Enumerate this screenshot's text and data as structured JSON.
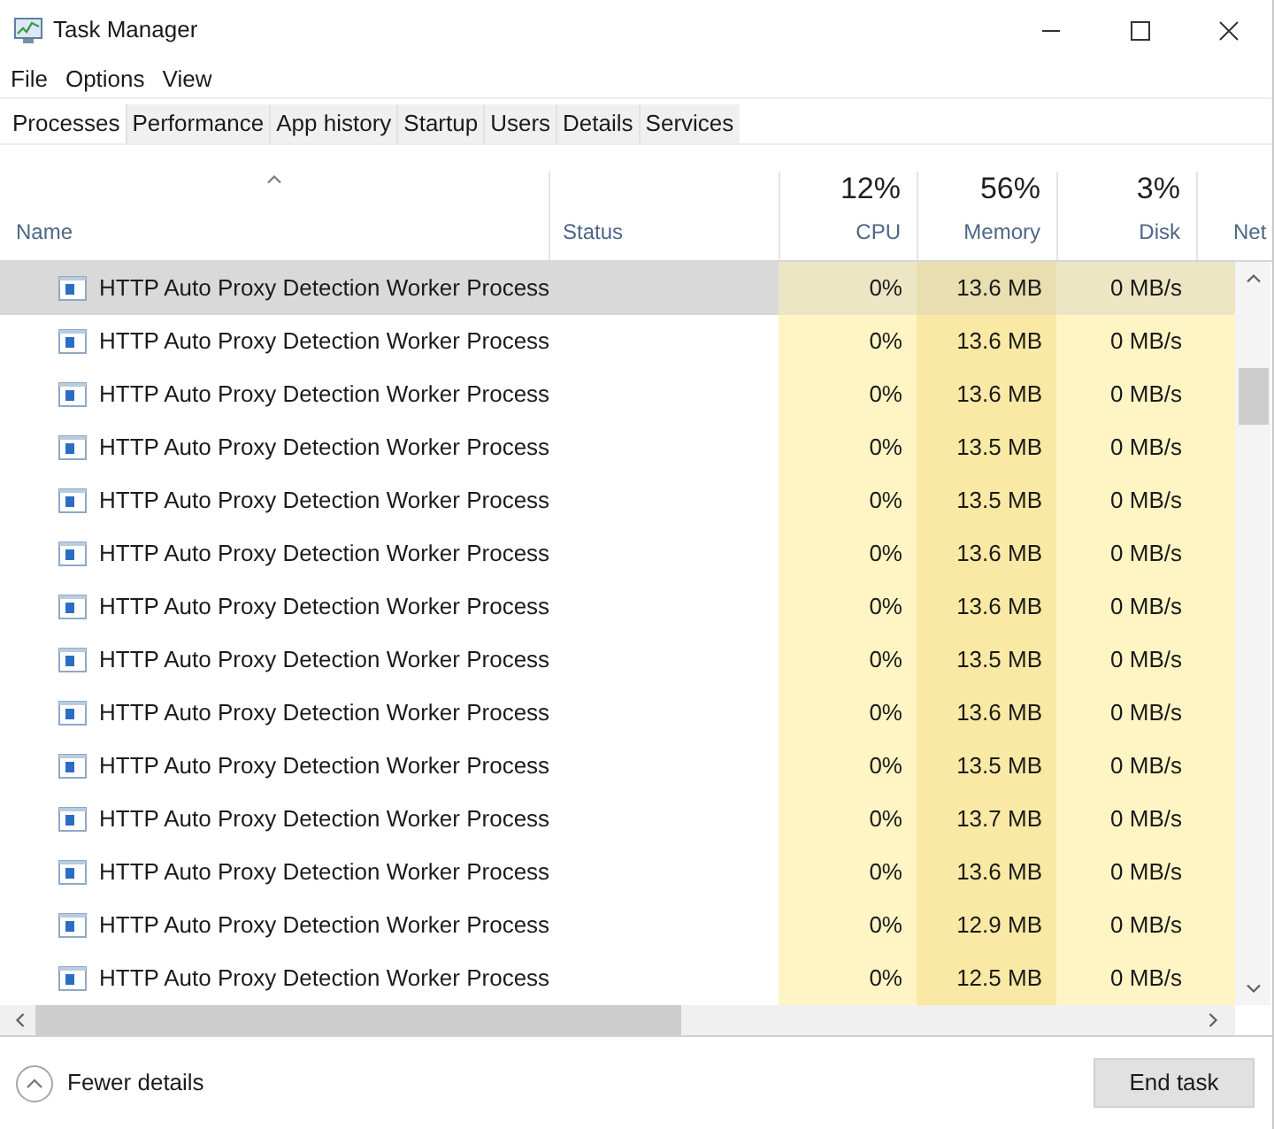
{
  "window": {
    "title": "Task Manager"
  },
  "menu": [
    {
      "label": "File"
    },
    {
      "label": "Options"
    },
    {
      "label": "View"
    }
  ],
  "tabs": [
    {
      "label": "Processes",
      "selected": true
    },
    {
      "label": "Performance",
      "selected": false
    },
    {
      "label": "App history",
      "selected": false
    },
    {
      "label": "Startup",
      "selected": false
    },
    {
      "label": "Users",
      "selected": false
    },
    {
      "label": "Details",
      "selected": false
    },
    {
      "label": "Services",
      "selected": false
    }
  ],
  "table": {
    "columns": [
      {
        "kind": "name",
        "label": "Name",
        "sorted": true
      },
      {
        "kind": "status",
        "label": "Status",
        "sorted": false
      },
      {
        "kind": "metric",
        "total": "12%",
        "label": "CPU",
        "sorted": false,
        "color": "#fff4c4"
      },
      {
        "kind": "metric",
        "total": "56%",
        "label": "Memory",
        "sorted": false,
        "color": "#f9e9a4"
      },
      {
        "kind": "metric",
        "total": "3%",
        "label": "Disk",
        "sorted": false,
        "color": "#fff4c4"
      },
      {
        "kind": "metric",
        "label": "Net",
        "sorted": false,
        "color": "#fff4c4"
      }
    ],
    "rows": [
      {
        "name": "HTTP Auto Proxy Detection Worker Process",
        "values": [
          "0%",
          "13.6 MB",
          "0 MB/s"
        ],
        "selected": true
      },
      {
        "name": "HTTP Auto Proxy Detection Worker Process",
        "values": [
          "0%",
          "13.6 MB",
          "0 MB/s"
        ],
        "selected": false
      },
      {
        "name": "HTTP Auto Proxy Detection Worker Process",
        "values": [
          "0%",
          "13.6 MB",
          "0 MB/s"
        ],
        "selected": false
      },
      {
        "name": "HTTP Auto Proxy Detection Worker Process",
        "values": [
          "0%",
          "13.5 MB",
          "0 MB/s"
        ],
        "selected": false
      },
      {
        "name": "HTTP Auto Proxy Detection Worker Process",
        "values": [
          "0%",
          "13.5 MB",
          "0 MB/s"
        ],
        "selected": false
      },
      {
        "name": "HTTP Auto Proxy Detection Worker Process",
        "values": [
          "0%",
          "13.6 MB",
          "0 MB/s"
        ],
        "selected": false
      },
      {
        "name": "HTTP Auto Proxy Detection Worker Process",
        "values": [
          "0%",
          "13.6 MB",
          "0 MB/s"
        ],
        "selected": false
      },
      {
        "name": "HTTP Auto Proxy Detection Worker Process",
        "values": [
          "0%",
          "13.5 MB",
          "0 MB/s"
        ],
        "selected": false
      },
      {
        "name": "HTTP Auto Proxy Detection Worker Process",
        "values": [
          "0%",
          "13.6 MB",
          "0 MB/s"
        ],
        "selected": false
      },
      {
        "name": "HTTP Auto Proxy Detection Worker Process",
        "values": [
          "0%",
          "13.5 MB",
          "0 MB/s"
        ],
        "selected": false
      },
      {
        "name": "HTTP Auto Proxy Detection Worker Process",
        "values": [
          "0%",
          "13.7 MB",
          "0 MB/s"
        ],
        "selected": false
      },
      {
        "name": "HTTP Auto Proxy Detection Worker Process",
        "values": [
          "0%",
          "13.6 MB",
          "0 MB/s"
        ],
        "selected": false
      },
      {
        "name": "HTTP Auto Proxy Detection Worker Process",
        "values": [
          "0%",
          "12.9 MB",
          "0 MB/s"
        ],
        "selected": false
      },
      {
        "name": "HTTP Auto Proxy Detection Worker Process",
        "values": [
          "0%",
          "12.5 MB",
          "0 MB/s"
        ],
        "selected": false
      }
    ]
  },
  "footer": {
    "details_toggle": "Fewer details",
    "end_task_button": "End task"
  }
}
